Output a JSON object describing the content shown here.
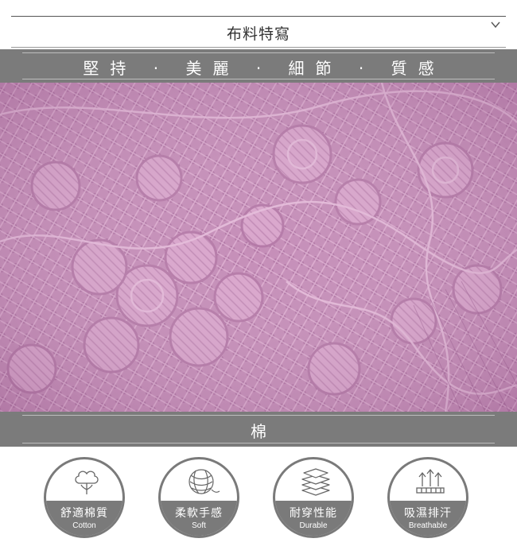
{
  "section": {
    "title": "布料特寫",
    "toggle_icon": "chevron-down-icon"
  },
  "top_banner": {
    "text": "堅持 · 美麗 · 細節 · 質感"
  },
  "fabric_image": {
    "subject": "pink lace fabric close-up",
    "colors": {
      "base": "#c58eb8",
      "light": "#e2b5d6",
      "dark": "#9d5f92"
    }
  },
  "material_banner": {
    "text": "棉"
  },
  "features": [
    {
      "zh": "舒適棉質",
      "en": "Cotton",
      "icon": "cotton-icon"
    },
    {
      "zh": "柔軟手感",
      "en": "Soft",
      "icon": "yarn-ball-icon"
    },
    {
      "zh": "耐穿性能",
      "en": "Durable",
      "icon": "layers-icon"
    },
    {
      "zh": "吸濕排汗",
      "en": "Breathable",
      "icon": "breathable-arrows-icon"
    }
  ],
  "colors": {
    "banner_bg": "#7b7b7b",
    "feature_gray": "#7a7a7a"
  }
}
